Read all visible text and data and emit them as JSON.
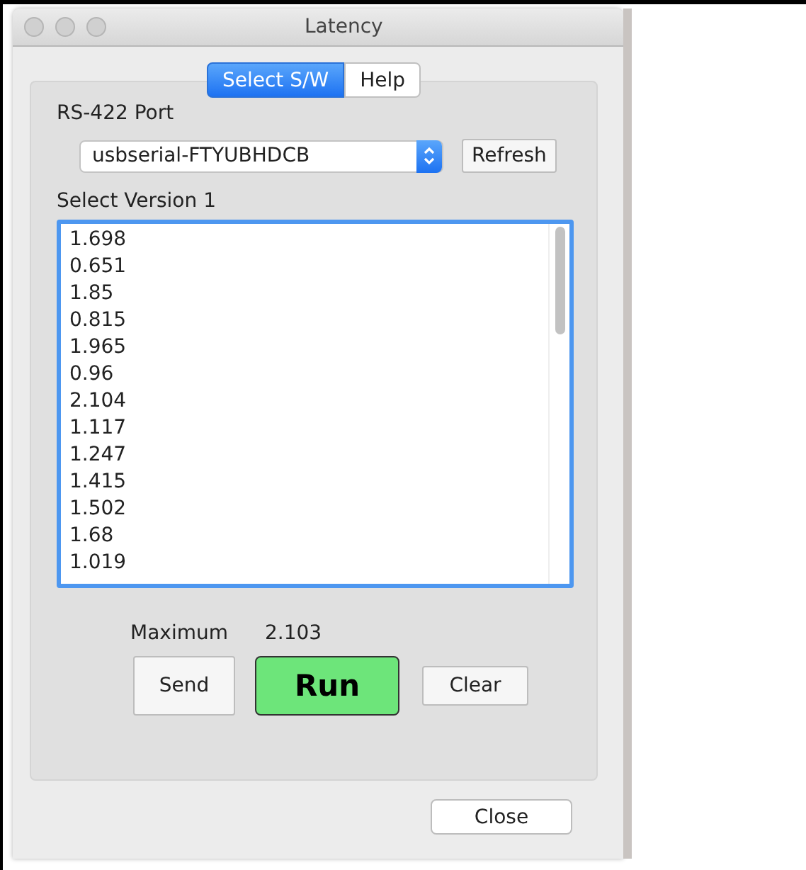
{
  "window": {
    "title": "Latency"
  },
  "tabs": [
    {
      "label": "Select S/W",
      "selected": true
    },
    {
      "label": "Help",
      "selected": false
    }
  ],
  "port": {
    "label": "RS-422 Port",
    "value": "usbserial-FTYUBHDCB",
    "refresh_button": "Refresh"
  },
  "version_list": {
    "label": "Select Version 1",
    "items": [
      "1.698",
      "0.651",
      "1.85",
      "0.815",
      "1.965",
      "0.96",
      "2.104",
      "1.117",
      "1.247",
      "1.415",
      "1.502",
      "1.68",
      "1.019"
    ]
  },
  "maximum": {
    "label": "Maximum",
    "value": "2.103"
  },
  "buttons": [
    {
      "label": "Send",
      "kind": "plain"
    },
    {
      "label": "Run",
      "kind": "primary"
    },
    {
      "label": "Clear",
      "kind": "small"
    }
  ],
  "close_button": "Close"
}
